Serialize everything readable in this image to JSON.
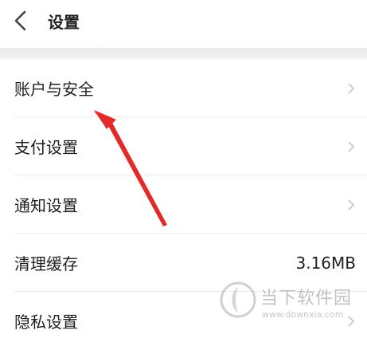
{
  "header": {
    "title": "设置",
    "back_icon": "chevron-left-icon"
  },
  "settings": [
    {
      "label": "账户与安全",
      "value": "",
      "has_chevron": true
    },
    {
      "label": "支付设置",
      "value": "",
      "has_chevron": true
    },
    {
      "label": "通知设置",
      "value": "",
      "has_chevron": true
    },
    {
      "label": "清理缓存",
      "value": "3.16MB",
      "has_chevron": false
    },
    {
      "label": "隐私设置",
      "value": "",
      "has_chevron": true
    }
  ],
  "watermark": {
    "title": "当下软件园",
    "url": "www.downxia.com"
  },
  "colors": {
    "annotation_arrow": "#e32b2b",
    "chevron": "#c4c4c4",
    "separator": "#eeeeee"
  }
}
